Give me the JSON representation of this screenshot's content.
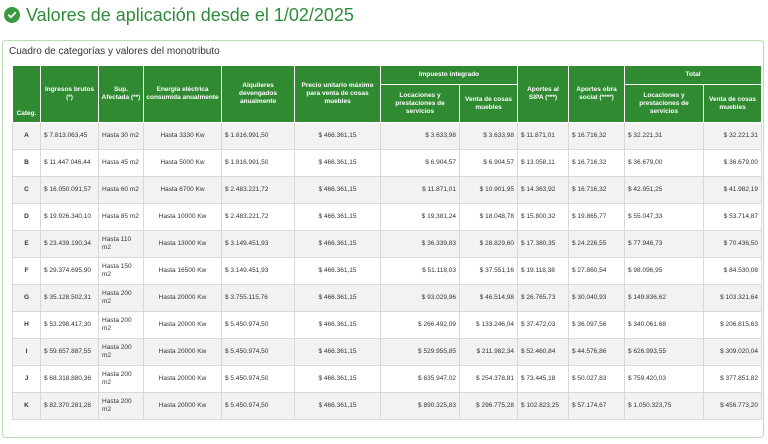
{
  "header": {
    "title": "Valores de aplicación desde el 1/02/2025",
    "icon": "check-circle-icon",
    "accent_color": "#2e8b3a"
  },
  "panel": {
    "title": "Cuadro de categorías y valores del monotributo"
  },
  "table": {
    "header_color": "#2f8a32",
    "columns": {
      "categ": "Categ.",
      "ingresos": "Ingresos brutos (*)",
      "sup": "Sup. Afectada (**)",
      "energia": "Energía eléctrica consumida anualmente",
      "alquileres": "Alquileres devengados anualmente",
      "precio": "Precio unitario máximo para venta de cosas muebles",
      "impuesto_group": "Impuesto integrado",
      "imp_locaciones": "Locaciones y prestaciones de servicios",
      "imp_venta": "Venta de cosas muebles",
      "sipa": "Aportes al SIPA (***)",
      "obra_social": "Aportes obra social (****)",
      "total_group": "Total",
      "tot_locaciones": "Locaciones y prestaciones de servicios",
      "tot_venta": "Venta de cosas muebles"
    },
    "rows": [
      {
        "cat": "A",
        "ingresos": "$ 7.813.063,45",
        "sup": "Hasta 30 m2",
        "energia": "Hasta 3330 Kw",
        "alquileres": "$ 1.816.991,50",
        "precio": "$ 466.361,15",
        "imp_loc": "$ 3.633,98",
        "imp_venta": "$ 3.633,98",
        "sipa": "$ 11.871,01",
        "obra": "$ 16.716,32",
        "tot_loc": "$ 32.221,31",
        "tot_venta": "$ 32.221,31"
      },
      {
        "cat": "B",
        "ingresos": "$ 11.447.046,44",
        "sup": "Hasta 45 m2",
        "energia": "Hasta 5000 Kw",
        "alquileres": "$ 1.816.991,50",
        "precio": "$ 466.361,15",
        "imp_loc": "$ 6.904,57",
        "imp_venta": "$ 6.904,57",
        "sipa": "$ 13.058,11",
        "obra": "$ 16.716,32",
        "tot_loc": "$ 36.679,00",
        "tot_venta": "$ 36.679,00"
      },
      {
        "cat": "C",
        "ingresos": "$ 16.050.091,57",
        "sup": "Hasta 60 m2",
        "energia": "Hasta 6700 Kw",
        "alquileres": "$ 2.483.221,72",
        "precio": "$ 466.361,15",
        "imp_loc": "$ 11.871,01",
        "imp_venta": "$ 10.901,95",
        "sipa": "$ 14.363,92",
        "obra": "$ 16.716,32",
        "tot_loc": "$ 42.951,25",
        "tot_venta": "$ 41.982,19"
      },
      {
        "cat": "D",
        "ingresos": "$ 19.926.340,10",
        "sup": "Hasta 85 m2",
        "energia": "Hasta 10000 Kw",
        "alquileres": "$ 2.483.221,72",
        "precio": "$ 466.361,15",
        "imp_loc": "$ 19.381,24",
        "imp_venta": "$ 18.048,78",
        "sipa": "$ 15.800,32",
        "obra": "$ 19.865,77",
        "tot_loc": "$ 55.047,33",
        "tot_venta": "$ 53.714,87"
      },
      {
        "cat": "E",
        "ingresos": "$ 23.439.190,34",
        "sup": "Hasta 110 m2",
        "energia": "Hasta 13000 Kw",
        "alquileres": "$ 3.149.451,93",
        "precio": "$ 466.361,15",
        "imp_loc": "$ 36.339,83",
        "imp_venta": "$ 28.829,60",
        "sipa": "$ 17.380,35",
        "obra": "$ 24.226,55",
        "tot_loc": "$ 77.946,73",
        "tot_venta": "$ 70.436,50"
      },
      {
        "cat": "F",
        "ingresos": "$ 29.374.695,90",
        "sup": "Hasta 150 m2",
        "energia": "Hasta 16500 Kw",
        "alquileres": "$ 3.149.451,93",
        "precio": "$ 466.361,15",
        "imp_loc": "$ 51.118,03",
        "imp_venta": "$ 37.551,16",
        "sipa": "$ 19.118,38",
        "obra": "$ 27.860,54",
        "tot_loc": "$ 98.096,95",
        "tot_venta": "$ 84.530,08"
      },
      {
        "cat": "G",
        "ingresos": "$ 35.128.502,31",
        "sup": "Hasta 200 m2",
        "energia": "Hasta 20000 Kw",
        "alquileres": "$ 3.755.115,76",
        "precio": "$ 466.361,15",
        "imp_loc": "$ 93.029,96",
        "imp_venta": "$ 46.514,98",
        "sipa": "$ 26.765,73",
        "obra": "$ 30.040,93",
        "tot_loc": "$ 149.836,62",
        "tot_venta": "$ 103.321,64"
      },
      {
        "cat": "H",
        "ingresos": "$ 53.298.417,30",
        "sup": "Hasta 200 m2",
        "energia": "Hasta 20000 Kw",
        "alquileres": "$ 5.450.974,50",
        "precio": "$ 466.361,15",
        "imp_loc": "$ 266.492,09",
        "imp_venta": "$ 133.246,04",
        "sipa": "$ 37.472,03",
        "obra": "$ 36.097,56",
        "tot_loc": "$ 340.061,68",
        "tot_venta": "$ 206.815,63"
      },
      {
        "cat": "I",
        "ingresos": "$ 59.657.887,55",
        "sup": "Hasta 200 m2",
        "energia": "Hasta 20000 Kw",
        "alquileres": "$ 5.450.974,50",
        "precio": "$ 466.361,15",
        "imp_loc": "$ 529.955,85",
        "imp_venta": "$ 211.982,34",
        "sipa": "$ 52.460,84",
        "obra": "$ 44.576,86",
        "tot_loc": "$ 626.993,55",
        "tot_venta": "$ 309.020,04"
      },
      {
        "cat": "J",
        "ingresos": "$ 68.318.880,36",
        "sup": "Hasta 200 m2",
        "energia": "Hasta 20000 Kw",
        "alquileres": "$ 5.450.974,50",
        "precio": "$ 466.361,15",
        "imp_loc": "$ 635.947,02",
        "imp_venta": "$ 254.378,81",
        "sipa": "$ 73.445,18",
        "obra": "$ 50.027,83",
        "tot_loc": "$ 759.420,03",
        "tot_venta": "$ 377.851,82"
      },
      {
        "cat": "K",
        "ingresos": "$ 82.370.281,28",
        "sup": "Hasta 200 m2",
        "energia": "Hasta 20000 Kw",
        "alquileres": "$ 5.450.974,50",
        "precio": "$ 466.361,15",
        "imp_loc": "$ 890.325,83",
        "imp_venta": "$ 296.775,28",
        "sipa": "$ 102.823,25",
        "obra": "$ 57.174,67",
        "tot_loc": "$ 1.050.323,75",
        "tot_venta": "$ 456.773,20"
      }
    ]
  }
}
